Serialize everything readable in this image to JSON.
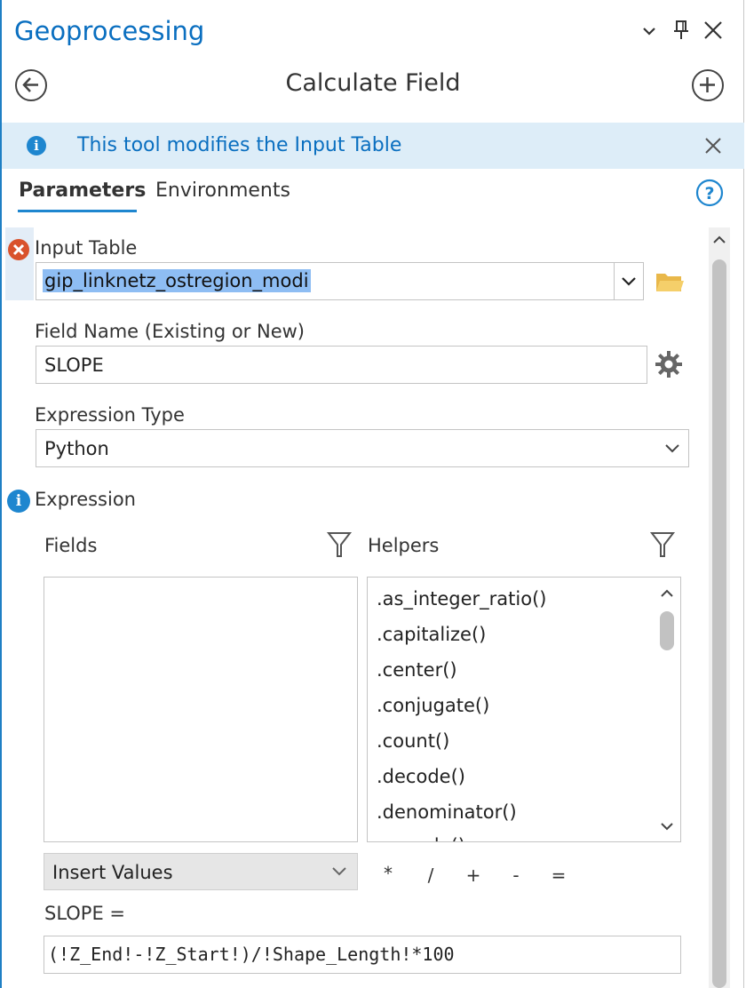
{
  "window": {
    "title": "Geoprocessing",
    "controls": {
      "dropdown_icon": "chevron-down-icon",
      "pin_icon": "pin-icon",
      "close_icon": "close-icon"
    }
  },
  "tool": {
    "title": "Calculate Field",
    "back_icon": "back-arrow-icon",
    "add_icon": "plus-circle-icon"
  },
  "banner": {
    "text": "This tool modifies the Input Table",
    "icon": "info-icon",
    "close_icon": "close-icon"
  },
  "tabs": [
    {
      "label": "Parameters",
      "active": true
    },
    {
      "label": "Environments",
      "active": false
    }
  ],
  "help_icon": "help-icon",
  "params": {
    "input_table": {
      "label": "Input Table",
      "value": "gip_linknetz_ostregion_modi",
      "status_icon": "error-icon",
      "browse_icon": "folder-icon"
    },
    "field_name": {
      "label": "Field Name (Existing or New)",
      "value": "SLOPE",
      "settings_icon": "gear-icon"
    },
    "expression_type": {
      "label": "Expression Type",
      "value": "Python"
    },
    "expression": {
      "label": "Expression",
      "info_icon": "info-icon",
      "fields_label": "Fields",
      "helpers_label": "Helpers",
      "helpers": [
        ".as_integer_ratio()",
        ".capitalize()",
        ".center()",
        ".conjugate()",
        ".count()",
        ".decode()",
        ".denominator()",
        ".encode()"
      ],
      "insert_values": "Insert Values",
      "operators": [
        "*",
        "/",
        "+",
        "-",
        "="
      ],
      "target_label": "SLOPE =",
      "code": "(!Z_End!-!Z_Start!)/!Shape_Length!*100"
    }
  },
  "colors": {
    "accent": "#0a6fc0",
    "banner_bg": "#ddedf8",
    "error": "#d9522c",
    "selection": "#3d8ee8"
  }
}
